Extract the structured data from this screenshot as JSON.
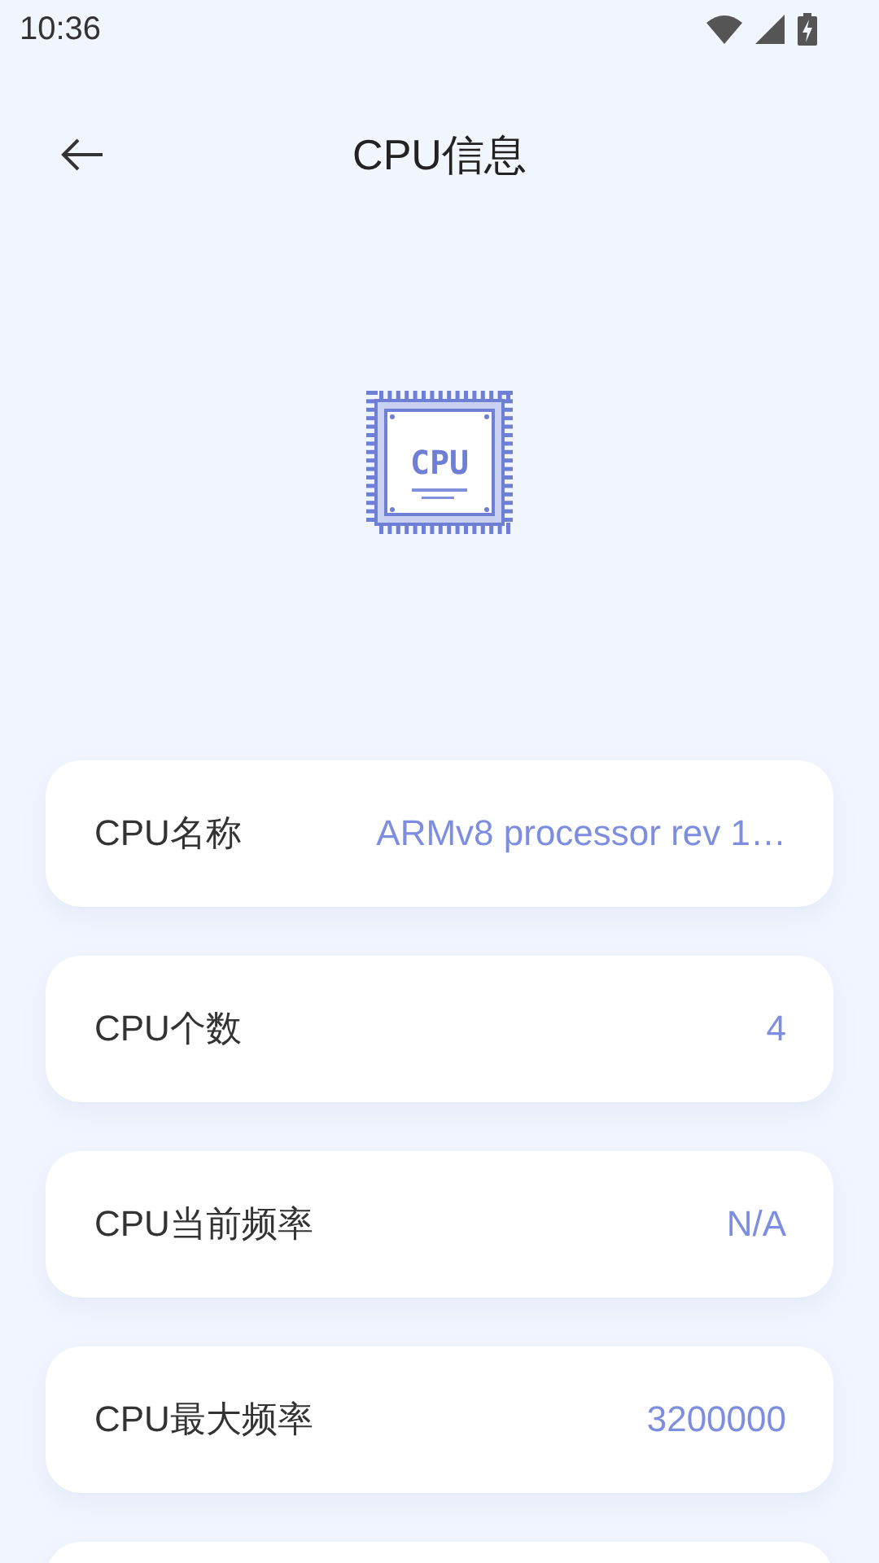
{
  "status_bar": {
    "time": "10:36"
  },
  "header": {
    "title": "CPU信息"
  },
  "chip": {
    "label": "CPU"
  },
  "rows": [
    {
      "label": "CPU名称",
      "value": "ARMv8 processor rev 1…"
    },
    {
      "label": "CPU个数",
      "value": "4"
    },
    {
      "label": "CPU当前频率",
      "value": "N/A"
    },
    {
      "label": "CPU最大频率",
      "value": "3200000"
    }
  ],
  "partial_row": true
}
